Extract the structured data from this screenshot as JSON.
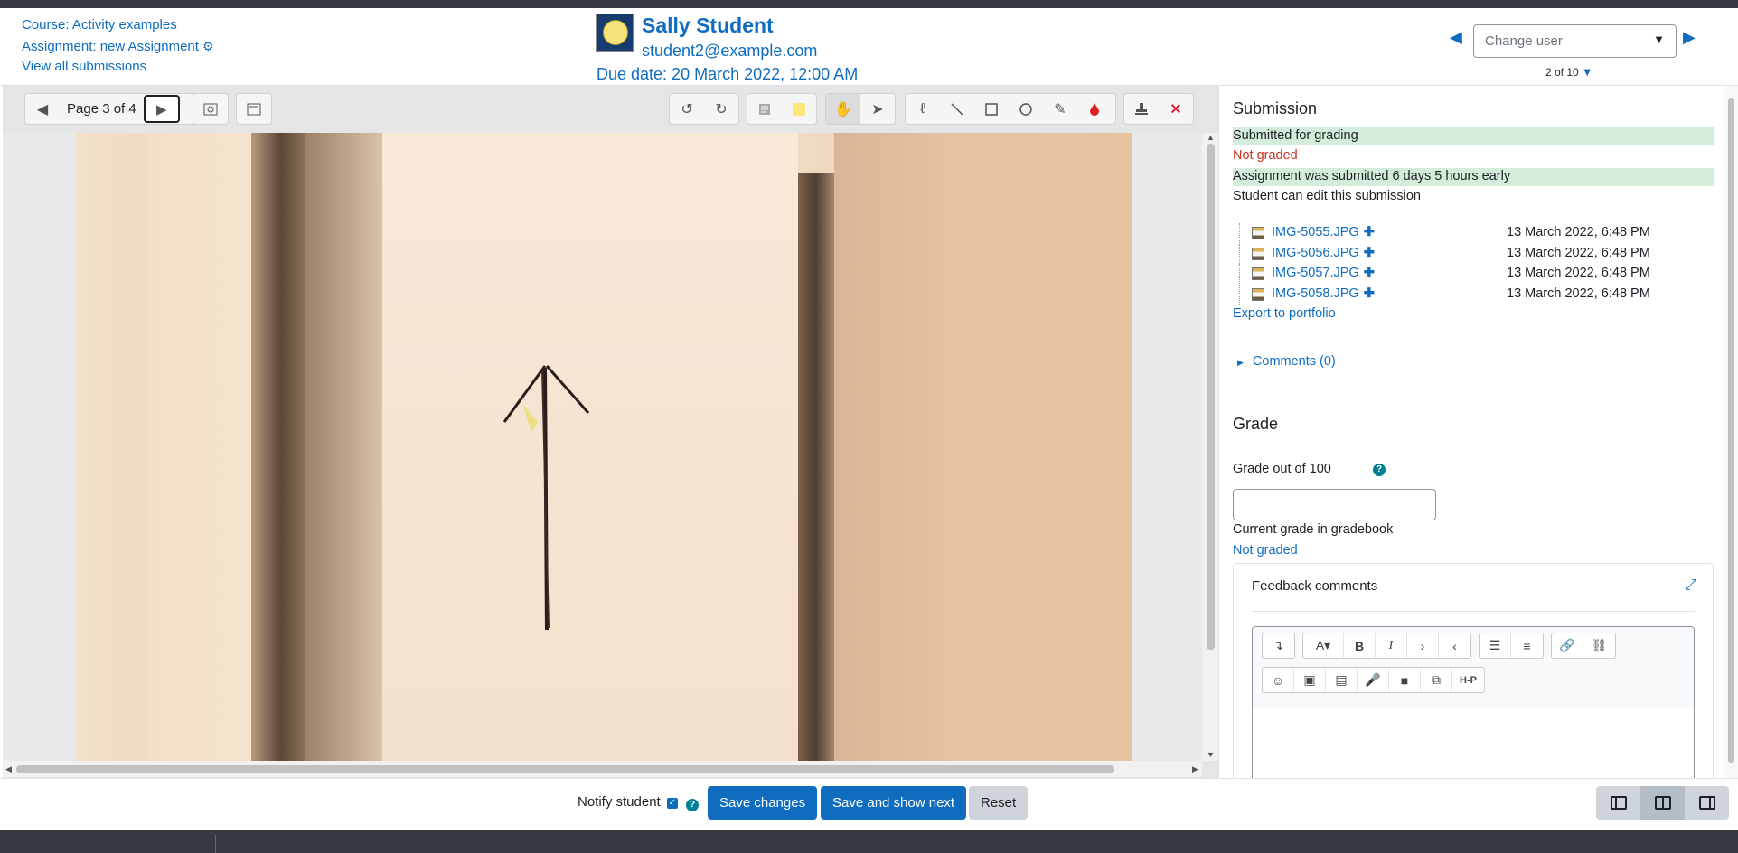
{
  "header": {
    "course_link": "Course: Activity examples",
    "assignment_link": "Assignment: new Assignment",
    "view_all_link": "View all submissions",
    "user_name": "Sally Student",
    "user_email": "student2@example.com",
    "due_date": "Due date: 20 March 2022, 12:00 AM",
    "change_user_placeholder": "Change user",
    "user_count": "2 of 10"
  },
  "viewer": {
    "page_label": "Page 3 of 4"
  },
  "submission": {
    "title": "Submission",
    "status_submitted": "Submitted for grading",
    "status_graded": "Not graded",
    "status_early": "Assignment was submitted 6 days 5 hours early",
    "status_edit": "Student can edit this submission",
    "files": [
      {
        "name": "IMG-5055.JPG",
        "date": "13 March 2022, 6:48 PM"
      },
      {
        "name": "IMG-5056.JPG",
        "date": "13 March 2022, 6:48 PM"
      },
      {
        "name": "IMG-5057.JPG",
        "date": "13 March 2022, 6:48 PM"
      },
      {
        "name": "IMG-5058.JPG",
        "date": "13 March 2022, 6:48 PM"
      }
    ],
    "export_link": "Export to portfolio",
    "comments_link": "Comments (0)"
  },
  "grade": {
    "title": "Grade",
    "grade_label": "Grade out of 100",
    "grade_value": "",
    "gradebook_label": "Current grade in gradebook",
    "gradebook_value": "Not graded",
    "feedback_title": "Feedback comments",
    "editor_h5p_label": "H-P"
  },
  "footer_bar": {
    "notify_label": "Notify student",
    "save_label": "Save changes",
    "save_next_label": "Save and show next",
    "reset_label": "Reset"
  },
  "colors": {
    "brand": "#0f6cbf",
    "success_bg": "#d4edda",
    "danger_text": "#ca3120",
    "dark_bar": "#343a40"
  }
}
